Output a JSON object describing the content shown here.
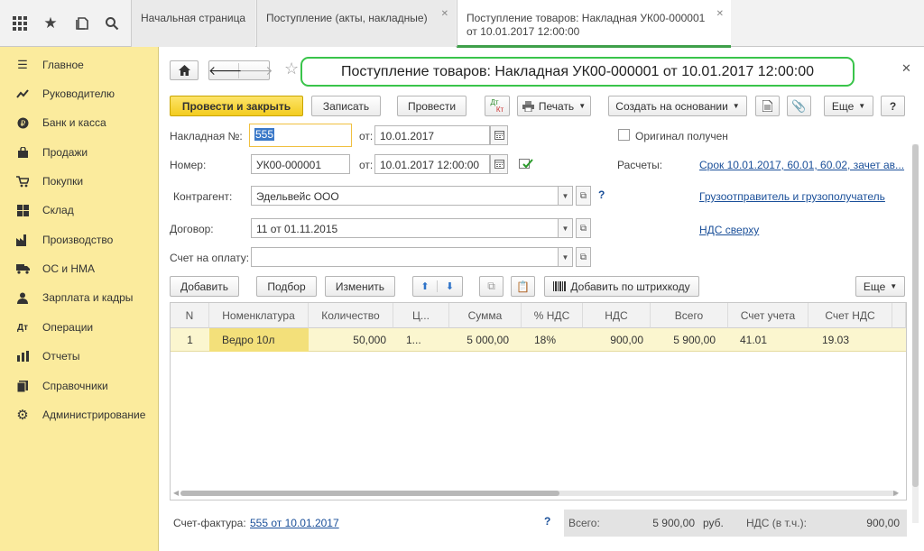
{
  "topbar": {
    "icons": [
      "grid-icon",
      "star-icon",
      "history-icon",
      "search-icon"
    ],
    "tabs": [
      {
        "line1": "Начальная страница",
        "line2": ""
      },
      {
        "line1": "Поступление (акты, накладные)",
        "line2": ""
      },
      {
        "line1": "Поступление товаров: Накладная УК00-000001",
        "line2": "от 10.01.2017 12:00:00"
      }
    ]
  },
  "sidebar": {
    "items": [
      {
        "label": "Главное",
        "icon": "menu-icon"
      },
      {
        "label": "Руководителю",
        "icon": "chart-line-icon"
      },
      {
        "label": "Банк и касса",
        "icon": "coin-icon"
      },
      {
        "label": "Продажи",
        "icon": "shopping-bag-icon"
      },
      {
        "label": "Покупки",
        "icon": "cart-icon"
      },
      {
        "label": "Склад",
        "icon": "warehouse-icon"
      },
      {
        "label": "Производство",
        "icon": "factory-icon"
      },
      {
        "label": "ОС и НМА",
        "icon": "truck-icon"
      },
      {
        "label": "Зарплата и кадры",
        "icon": "person-icon"
      },
      {
        "label": "Операции",
        "icon": "operations-icon"
      },
      {
        "label": "Отчеты",
        "icon": "bar-chart-icon"
      },
      {
        "label": "Справочники",
        "icon": "book-icon"
      },
      {
        "label": "Администрирование",
        "icon": "gear-icon"
      }
    ]
  },
  "document": {
    "title": "Поступление товаров: Накладная УК00-000001 от 10.01.2017 12:00:00",
    "toolbar": {
      "post_close": "Провести и закрыть",
      "save": "Записать",
      "post": "Провести",
      "dt_kt_top": "Дт",
      "dt_kt_bottom": "Кт",
      "print": "Печать",
      "create_based": "Создать на основании",
      "more": "Еще",
      "help": "?"
    },
    "fields": {
      "invoice_no_label": "Накладная №:",
      "invoice_no_value": "555",
      "from_label": "от:",
      "invoice_date": "10.01.2017",
      "number_label": "Номер:",
      "number_value": "УК00-000001",
      "number_date": "10.01.2017 12:00:00",
      "original_label": "Оригинал получен",
      "settlements_label": "Расчеты:",
      "settlements_link": "Срок 10.01.2017, 60.01, 60.02, зачет ав...",
      "counterparty_label": "Контрагент:",
      "counterparty_value": "Эдельвейс ООО",
      "help_q": "?",
      "shipper_link": "Грузоотправитель и грузополучатель",
      "contract_label": "Договор:",
      "contract_value": "11 от 01.11.2015",
      "vat_link": "НДС сверху",
      "invoice_pay_label": "Счет на оплату:",
      "invoice_pay_value": ""
    },
    "table_toolbar": {
      "add": "Добавить",
      "select": "Подбор",
      "change": "Изменить",
      "barcode": "Добавить по штрихкоду",
      "more": "Еще"
    },
    "table": {
      "columns": [
        "N",
        "Номенклатура",
        "Количество",
        "Ц...",
        "Сумма",
        "% НДС",
        "НДС",
        "Всего",
        "Счет учета",
        "Счет НДС"
      ],
      "rows": [
        [
          "1",
          "Ведро 10л",
          "50,000",
          "1...",
          "5 000,00",
          "18%",
          "900,00",
          "5 900,00",
          "41.01",
          "19.03"
        ]
      ]
    },
    "footer": {
      "invoice_label": "Счет-фактура:",
      "invoice_link": "555 от 10.01.2017",
      "help_q": "?",
      "total_label": "Всего:",
      "total_value": "5 900,00",
      "currency": "руб.",
      "vat_label": "НДС (в т.ч.):",
      "vat_value": "900,00"
    }
  },
  "colors": {
    "sidebar_bg": "#fbeb9d",
    "primary_button": "#f3cc1e",
    "title_highlight": "#39c44a",
    "link": "#1a4f99",
    "selected_row": "#fbf6cf"
  }
}
